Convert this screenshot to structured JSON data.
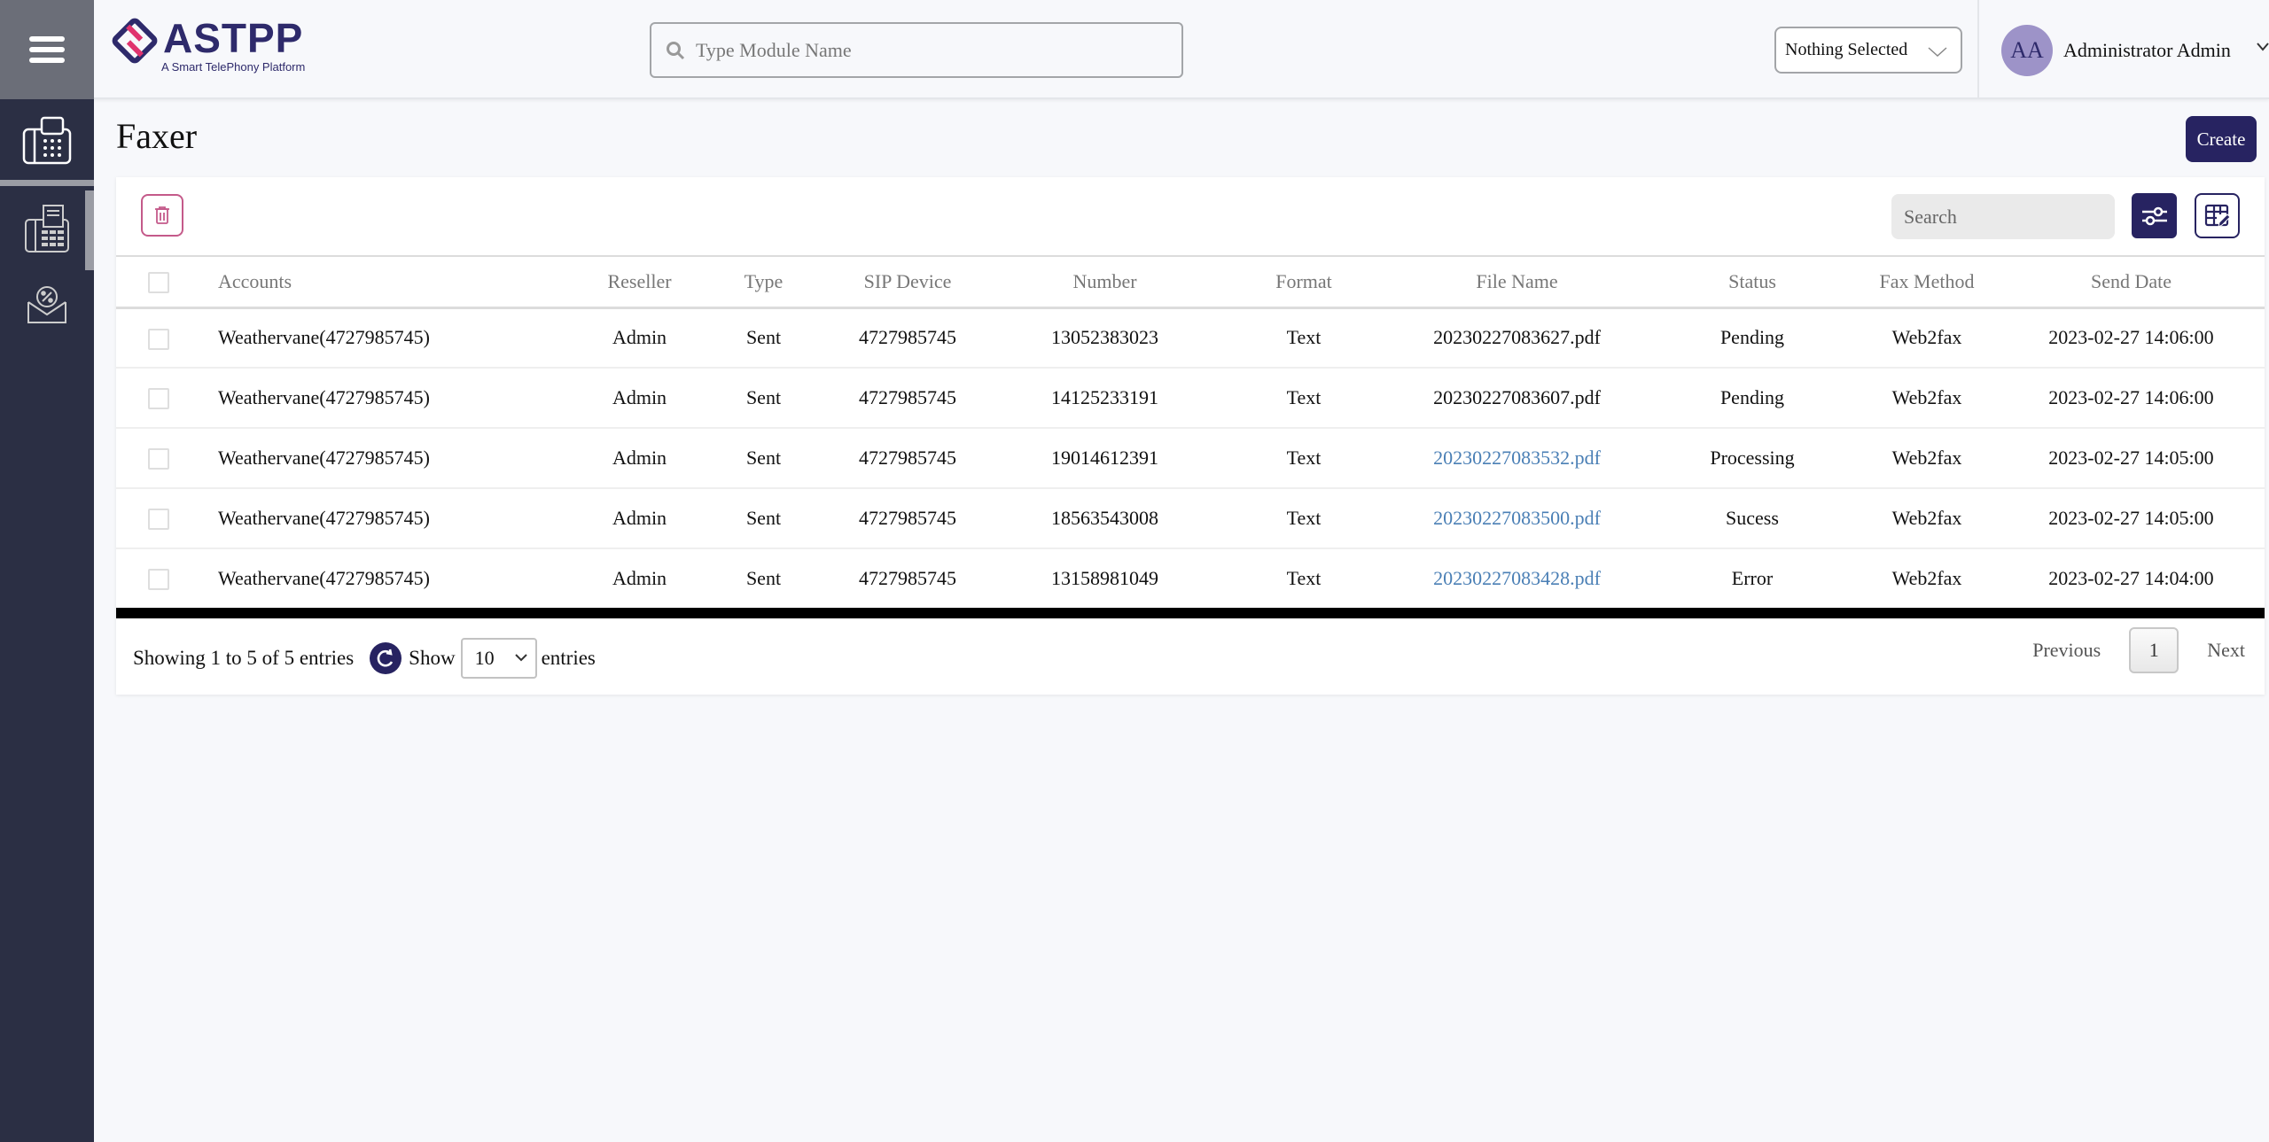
{
  "app": {
    "brand": "ASTPP",
    "tagline": "A Smart TelePhony Platform",
    "colors": {
      "primary": "#272361",
      "sidebar": "#2b2f44",
      "danger_accent": "#c45a8a",
      "link": "#4a7fb5"
    }
  },
  "sidebar": {
    "items": [
      {
        "icon": "fax-machine-icon",
        "active": true
      },
      {
        "icon": "fax-document-icon",
        "active": false
      },
      {
        "icon": "email-percent-icon",
        "active": false
      }
    ]
  },
  "header": {
    "module_search": {
      "placeholder": "Type Module Name",
      "value": ""
    },
    "select": {
      "value": "Nothing Selected"
    },
    "user": {
      "initials": "AA",
      "name": "Administrator Admin"
    }
  },
  "page": {
    "title": "Faxer",
    "create_label": "Create"
  },
  "toolbar": {
    "search_placeholder": "Search"
  },
  "table": {
    "columns": [
      "Accounts",
      "Reseller",
      "Type",
      "SIP Device",
      "Number",
      "Format",
      "File Name",
      "Status",
      "Fax Method",
      "Send Date"
    ],
    "rows": [
      {
        "account": "Weathervane(4727985745)",
        "reseller": "Admin",
        "type": "Sent",
        "sip_device": "4727985745",
        "number": "13052383023",
        "format": "Text",
        "file_name": "20230227083627.pdf",
        "file_link": false,
        "status": "Pending",
        "fax_method": "Web2fax",
        "send_date": "2023-02-27 14:06:00"
      },
      {
        "account": "Weathervane(4727985745)",
        "reseller": "Admin",
        "type": "Sent",
        "sip_device": "4727985745",
        "number": "14125233191",
        "format": "Text",
        "file_name": "20230227083607.pdf",
        "file_link": false,
        "status": "Pending",
        "fax_method": "Web2fax",
        "send_date": "2023-02-27 14:06:00"
      },
      {
        "account": "Weathervane(4727985745)",
        "reseller": "Admin",
        "type": "Sent",
        "sip_device": "4727985745",
        "number": "19014612391",
        "format": "Text",
        "file_name": "20230227083532.pdf",
        "file_link": true,
        "status": "Processing",
        "fax_method": "Web2fax",
        "send_date": "2023-02-27 14:05:00"
      },
      {
        "account": "Weathervane(4727985745)",
        "reseller": "Admin",
        "type": "Sent",
        "sip_device": "4727985745",
        "number": "18563543008",
        "format": "Text",
        "file_name": "20230227083500.pdf",
        "file_link": true,
        "status": "Sucess",
        "fax_method": "Web2fax",
        "send_date": "2023-02-27 14:05:00"
      },
      {
        "account": "Weathervane(4727985745)",
        "reseller": "Admin",
        "type": "Sent",
        "sip_device": "4727985745",
        "number": "13158981049",
        "format": "Text",
        "file_name": "20230227083428.pdf",
        "file_link": true,
        "status": "Error",
        "fax_method": "Web2fax",
        "send_date": "2023-02-27 14:04:00"
      }
    ]
  },
  "footer": {
    "info": "Showing 1 to 5 of 5 entries",
    "show_label": "Show",
    "page_length": "10",
    "entries_label": "entries",
    "previous": "Previous",
    "current_page": "1",
    "next": "Next"
  }
}
